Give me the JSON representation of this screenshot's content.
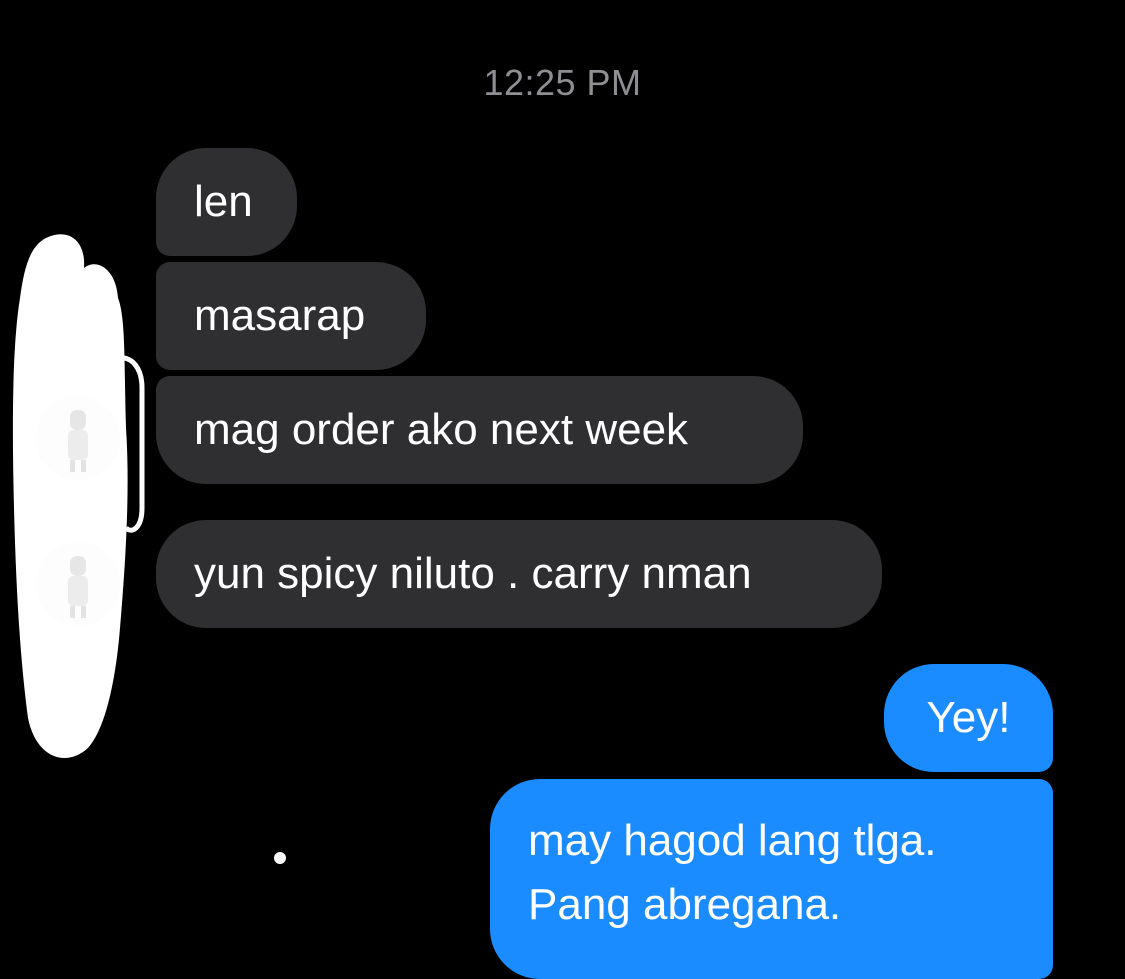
{
  "timestamp": "12:25 PM",
  "incoming_messages": [
    {
      "text": "len"
    },
    {
      "text": "masarap"
    },
    {
      "text": "mag order ako next week"
    },
    {
      "text": "yun spicy niluto . carry nman"
    }
  ],
  "outgoing_messages": [
    {
      "text": "Yey!"
    },
    {
      "lines": [
        "may hagod lang tlga.",
        "Pang abregana."
      ]
    }
  ],
  "colors": {
    "background": "#000000",
    "incoming_bubble": "#2f2f31",
    "outgoing_bubble": "#1a8cff",
    "timestamp": "#8e8e93",
    "redaction": "#ffffff"
  },
  "icons": {
    "avatar": "avatar-icon",
    "redaction": "redaction-scribble",
    "indicator": "dot-indicator"
  }
}
